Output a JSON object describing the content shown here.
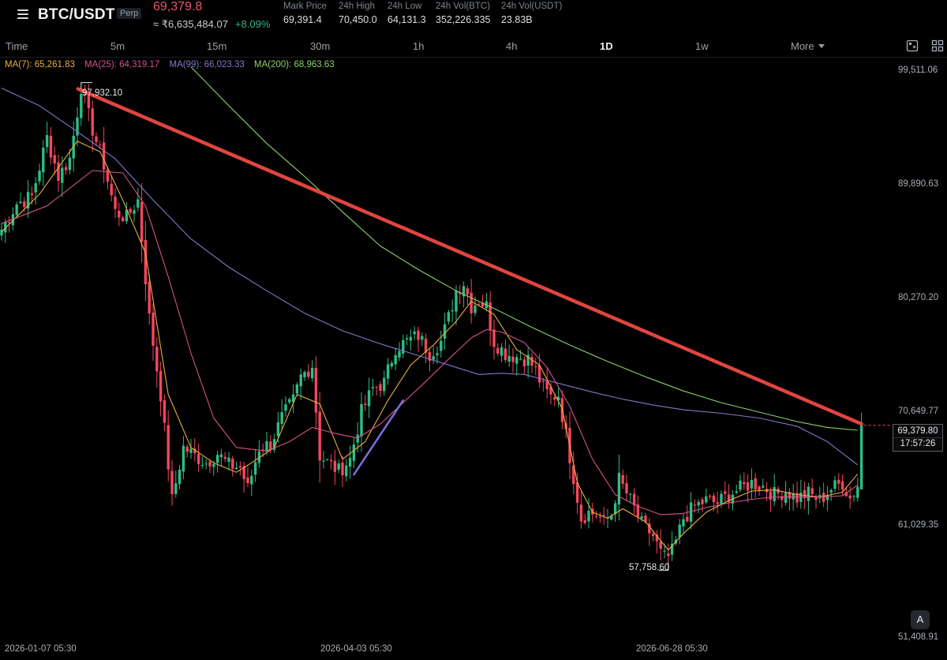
{
  "header": {
    "symbol": "BTC/USDT",
    "contract_tag": "Perp",
    "last_price": "69,379.8",
    "inr_value": "≈ ₹6,635,484.07",
    "change_pct": "+8.09%",
    "stats": [
      {
        "label": "Mark Price",
        "value": "69,391.4"
      },
      {
        "label": "24h High",
        "value": "70,450.0"
      },
      {
        "label": "24h Low",
        "value": "64,131.3"
      },
      {
        "label": "24h Vol(BTC)",
        "value": "352,226.335"
      },
      {
        "label": "24h Vol(USDT)",
        "value": "23.83B"
      }
    ]
  },
  "timeframes": {
    "items": [
      "Time",
      "5m",
      "15m",
      "30m",
      "1h",
      "4h",
      "1D",
      "1w",
      "More"
    ],
    "active": "1D"
  },
  "moving_averages": [
    {
      "label": "MA(7): 65,261.83",
      "color": "#e9b03d"
    },
    {
      "label": "MA(25): 64,319.17",
      "color": "#d6518c"
    },
    {
      "label": "MA(99): 66,023.33",
      "color": "#8177c9"
    },
    {
      "label": "MA(200): 68,963.63",
      "color": "#8ed06a"
    }
  ],
  "price_axis": [
    "99,511.06",
    "89,890.63",
    "80,270.20",
    "70,649.77",
    "61,029.35",
    "51,408.91"
  ],
  "time_axis": [
    "2026-01-07 05:30",
    "2026-04-03 05:30",
    "2026-06-28 05:30"
  ],
  "current_price": {
    "price": "69,379.80",
    "countdown": "17:57:26"
  },
  "annotations": {
    "high": "97,932.10",
    "low": "57,758.60"
  },
  "button_a": "A",
  "colors": {
    "up": "#2ebd85",
    "down": "#f6465d",
    "trendline": "#e0453f",
    "trend_up_line": "#7b6fe0",
    "brand": "#eef0f3"
  },
  "chart_data": {
    "type": "candlestick",
    "title": "",
    "x_label": "",
    "y_label": "",
    "y_range": [
      51408.91,
      99511.06
    ],
    "path_points": [
      [
        0,
        86000
      ],
      [
        4,
        88200
      ],
      [
        8,
        88800
      ],
      [
        12,
        93800
      ],
      [
        15,
        90500
      ],
      [
        18,
        92000
      ],
      [
        21,
        97932
      ],
      [
        24,
        94500
      ],
      [
        27,
        91500
      ],
      [
        30,
        87500
      ],
      [
        33,
        87000
      ],
      [
        36,
        88500
      ],
      [
        39,
        78500
      ],
      [
        42,
        72000
      ],
      [
        45,
        63000
      ],
      [
        48,
        67500
      ],
      [
        51,
        66800
      ],
      [
        54,
        66200
      ],
      [
        57,
        67000
      ],
      [
        60,
        66000
      ],
      [
        63,
        65800
      ],
      [
        65,
        64000
      ],
      [
        68,
        67500
      ],
      [
        71,
        67800
      ],
      [
        74,
        70000
      ],
      [
        77,
        71500
      ],
      [
        79,
        73500
      ],
      [
        82,
        74500
      ],
      [
        84,
        66800
      ],
      [
        87,
        66000
      ],
      [
        89,
        65500
      ],
      [
        92,
        66500
      ],
      [
        95,
        70500
      ],
      [
        98,
        72500
      ],
      [
        101,
        73000
      ],
      [
        104,
        76000
      ],
      [
        107,
        76500
      ],
      [
        110,
        77000
      ],
      [
        113,
        75500
      ],
      [
        116,
        76500
      ],
      [
        118,
        78500
      ],
      [
        120,
        80800
      ],
      [
        122,
        81500
      ],
      [
        124,
        79500
      ],
      [
        126,
        80000
      ],
      [
        128,
        79500
      ],
      [
        130,
        76500
      ],
      [
        133,
        75500
      ],
      [
        136,
        75200
      ],
      [
        139,
        75000
      ],
      [
        141,
        74000
      ],
      [
        143,
        72500
      ],
      [
        145,
        71800
      ],
      [
        147,
        72000
      ],
      [
        149,
        68500
      ],
      [
        151,
        65000
      ],
      [
        153,
        61500
      ],
      [
        155,
        62000
      ],
      [
        157,
        61800
      ],
      [
        159,
        61200
      ],
      [
        161,
        61800
      ],
      [
        163,
        64800
      ],
      [
        166,
        63000
      ],
      [
        169,
        61000
      ],
      [
        172,
        60000
      ],
      [
        174,
        58500
      ],
      [
        176,
        57800
      ],
      [
        178,
        59500
      ],
      [
        180,
        61500
      ],
      [
        183,
        62500
      ],
      [
        186,
        63000
      ],
      [
        189,
        62800
      ],
      [
        192,
        63500
      ],
      [
        195,
        64000
      ],
      [
        198,
        64500
      ],
      [
        201,
        64200
      ],
      [
        204,
        63500
      ],
      [
        207,
        63800
      ],
      [
        210,
        63200
      ],
      [
        213,
        63600
      ],
      [
        216,
        63000
      ],
      [
        219,
        64000
      ],
      [
        222,
        64500
      ],
      [
        224,
        63200
      ],
      [
        226,
        64300
      ],
      [
        227,
        69380
      ]
    ],
    "moving_averages": [
      {
        "name": "MA(7)",
        "last": 65261.83,
        "points": [
          [
            0,
            85800
          ],
          [
            10,
            89000
          ],
          [
            20,
            93500
          ],
          [
            26,
            92600
          ],
          [
            32,
            88500
          ],
          [
            38,
            84000
          ],
          [
            44,
            72000
          ],
          [
            50,
            67500
          ],
          [
            56,
            66200
          ],
          [
            62,
            65400
          ],
          [
            66,
            66200
          ],
          [
            72,
            67500
          ],
          [
            78,
            72000
          ],
          [
            84,
            71200
          ],
          [
            90,
            66500
          ],
          [
            96,
            68000
          ],
          [
            102,
            71500
          ],
          [
            108,
            74500
          ],
          [
            114,
            76200
          ],
          [
            120,
            78200
          ],
          [
            124,
            79900
          ],
          [
            130,
            78800
          ],
          [
            136,
            75800
          ],
          [
            142,
            74500
          ],
          [
            148,
            70800
          ],
          [
            152,
            64500
          ],
          [
            156,
            62000
          ],
          [
            160,
            61500
          ],
          [
            164,
            62300
          ],
          [
            170,
            61200
          ],
          [
            176,
            58800
          ],
          [
            180,
            60200
          ],
          [
            186,
            62000
          ],
          [
            192,
            63000
          ],
          [
            198,
            63800
          ],
          [
            204,
            63900
          ],
          [
            210,
            63500
          ],
          [
            216,
            63300
          ],
          [
            222,
            63700
          ],
          [
            226,
            65260
          ]
        ]
      },
      {
        "name": "MA(25)",
        "last": 64319.17,
        "points": [
          [
            0,
            86500
          ],
          [
            12,
            88000
          ],
          [
            24,
            91000
          ],
          [
            32,
            90800
          ],
          [
            38,
            88000
          ],
          [
            44,
            82000
          ],
          [
            50,
            75500
          ],
          [
            56,
            70000
          ],
          [
            62,
            67500
          ],
          [
            70,
            67200
          ],
          [
            76,
            68000
          ],
          [
            82,
            69200
          ],
          [
            88,
            68700
          ],
          [
            94,
            68300
          ],
          [
            100,
            69500
          ],
          [
            106,
            71300
          ],
          [
            112,
            73100
          ],
          [
            118,
            75000
          ],
          [
            124,
            76800
          ],
          [
            128,
            77500
          ],
          [
            132,
            77300
          ],
          [
            138,
            76400
          ],
          [
            144,
            74300
          ],
          [
            150,
            71000
          ],
          [
            156,
            66500
          ],
          [
            162,
            63500
          ],
          [
            168,
            62500
          ],
          [
            174,
            61800
          ],
          [
            180,
            61900
          ],
          [
            186,
            62400
          ],
          [
            192,
            62800
          ],
          [
            198,
            63100
          ],
          [
            204,
            63300
          ],
          [
            210,
            63300
          ],
          [
            216,
            63300
          ],
          [
            222,
            63400
          ],
          [
            226,
            64320
          ]
        ]
      },
      {
        "name": "MA(99)",
        "last": 66023.33,
        "points": [
          [
            0,
            98000
          ],
          [
            10,
            96500
          ],
          [
            20,
            94300
          ],
          [
            30,
            92000
          ],
          [
            40,
            88500
          ],
          [
            50,
            85200
          ],
          [
            60,
            82800
          ],
          [
            70,
            80800
          ],
          [
            80,
            78900
          ],
          [
            90,
            77400
          ],
          [
            100,
            76300
          ],
          [
            110,
            75300
          ],
          [
            120,
            74300
          ],
          [
            126,
            73700
          ],
          [
            132,
            73800
          ],
          [
            138,
            73700
          ],
          [
            144,
            73200
          ],
          [
            150,
            72700
          ],
          [
            156,
            72200
          ],
          [
            164,
            71600
          ],
          [
            172,
            71100
          ],
          [
            180,
            70700
          ],
          [
            190,
            70400
          ],
          [
            200,
            70000
          ],
          [
            210,
            69300
          ],
          [
            218,
            68000
          ],
          [
            226,
            66020
          ]
        ]
      },
      {
        "name": "MA(200)",
        "last": 68963.63,
        "points": [
          [
            50,
            99800
          ],
          [
            60,
            96500
          ],
          [
            70,
            93300
          ],
          [
            80,
            90500
          ],
          [
            90,
            87500
          ],
          [
            100,
            84600
          ],
          [
            110,
            82600
          ],
          [
            120,
            80800
          ],
          [
            130,
            79300
          ],
          [
            140,
            77700
          ],
          [
            150,
            76200
          ],
          [
            160,
            74800
          ],
          [
            170,
            73500
          ],
          [
            180,
            72300
          ],
          [
            190,
            71300
          ],
          [
            200,
            70500
          ],
          [
            210,
            69700
          ],
          [
            218,
            69200
          ],
          [
            226,
            68960
          ]
        ]
      }
    ],
    "trendlines": [
      {
        "from": [
          21,
          97932.1
        ],
        "to": [
          227,
          69500
        ]
      },
      {
        "from": [
          93,
          65200
        ],
        "to": [
          106,
          71500
        ]
      }
    ],
    "high_point": 97932.1,
    "low_point": 57758.6,
    "last_price": 69379.8,
    "x_ticks": [
      "2026-01-07 05:30",
      "2026-04-03 05:30",
      "2026-06-28 05:30"
    ],
    "y_ticks": [
      99511.06,
      89890.63,
      80270.2,
      70649.77,
      61029.35,
      51408.91
    ]
  }
}
